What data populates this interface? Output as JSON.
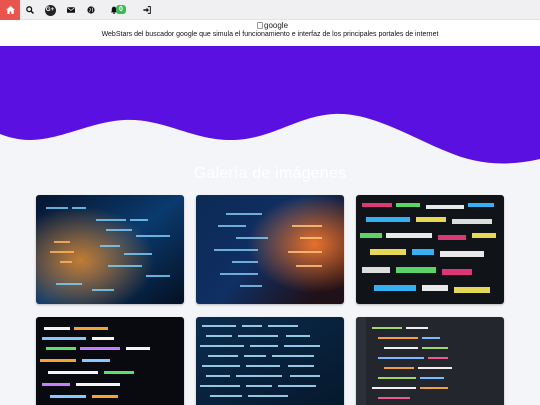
{
  "nav": {
    "notification_count": "0",
    "google_plus_label": "G+",
    "icons": [
      "home-icon",
      "search-icon",
      "google-plus-icon",
      "mail-icon",
      "globe-icon",
      "bell-icon",
      "login-icon"
    ]
  },
  "brand": {
    "logo_alt": "google",
    "tagline": "WebStars del buscador google que simula el funcionamiento e interfaz de los principales portales de internet"
  },
  "hero": {
    "background_color": "#5a10e0",
    "title": "Galería de imágenes"
  },
  "gallery": {
    "images": [
      {
        "subject": "code-screen-blue-orange"
      },
      {
        "subject": "code-screen-blue-orange"
      },
      {
        "subject": "code-screen-colorful"
      },
      {
        "subject": "code-screen-dark"
      },
      {
        "subject": "code-screen-blue"
      },
      {
        "subject": "code-screen-dark"
      }
    ]
  },
  "colors": {
    "accent_home": "#e8554e",
    "badge": "#3cba54",
    "hero": "#5a10e0",
    "page_bg": "#f4f5f8"
  }
}
